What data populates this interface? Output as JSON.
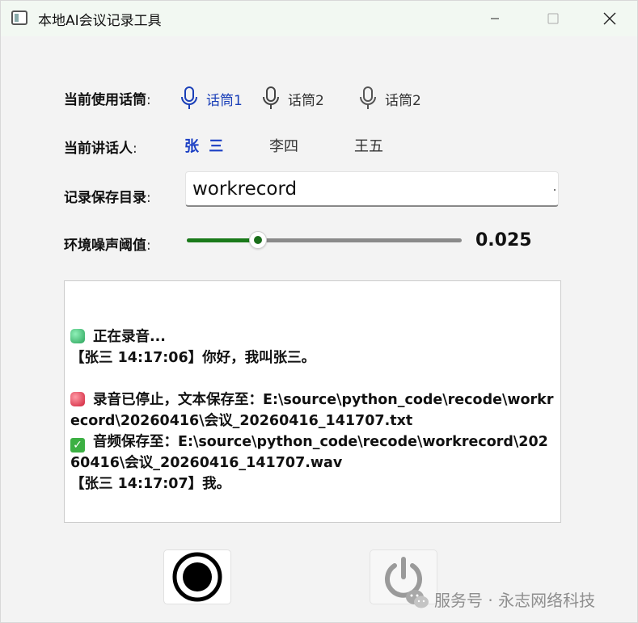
{
  "window": {
    "title": "本地AI会议记录工具",
    "controls": {
      "minimize_icon": "minimize-icon",
      "maximize_icon": "maximize-icon",
      "close_icon": "close-icon"
    }
  },
  "microphone": {
    "label": "当前使用话筒",
    "colon": ":",
    "options": [
      {
        "label": "话筒1",
        "icon": "microphone-icon",
        "selected": true
      },
      {
        "label": "话筒2",
        "icon": "microphone-icon",
        "selected": false
      },
      {
        "label": "话筒2",
        "icon": "microphone-icon",
        "selected": false
      }
    ]
  },
  "speaker": {
    "label": "当前讲话人",
    "colon": ":",
    "options": [
      {
        "label": "张 三",
        "selected": true
      },
      {
        "label": "李四",
        "selected": false
      },
      {
        "label": "王五",
        "selected": false
      }
    ]
  },
  "save_dir": {
    "label": "记录保存目录",
    "colon": ":",
    "value": "workrecord"
  },
  "noise": {
    "label": "环境噪声阈值",
    "colon": ":",
    "value_text": "0.025",
    "slider_fraction": 0.26
  },
  "log": {
    "lines": [
      {
        "icon": "",
        "text": ""
      },
      {
        "icon": "green-status-icon",
        "text": "正在录音..."
      },
      {
        "icon": "",
        "text": "【张三 14:17:06】你好，我叫张三。"
      },
      {
        "icon": "",
        "text": ""
      },
      {
        "icon": "red-status-icon",
        "text": "录音已停止，文本保存至：E:\\source\\python_code\\recode\\workrecord\\20260416\\会议_20260416_141707.txt"
      },
      {
        "icon": "check-icon",
        "text": "音频保存至：E:\\source\\python_code\\recode\\workrecord\\20260416\\会议_20260416_141707.wav"
      },
      {
        "icon": "",
        "text": "【张三 14:17:07】我。"
      }
    ]
  },
  "buttons": {
    "record_icon": "record-icon",
    "power_icon": "power-icon"
  },
  "watermark": {
    "text": "服务号 · 永志网络科技",
    "icon": "wechat-icon"
  },
  "colors": {
    "accent_blue": "#1a3fb8",
    "slider_green": "#1a7a1a",
    "titlebar_bg": "#f2f8f2"
  }
}
